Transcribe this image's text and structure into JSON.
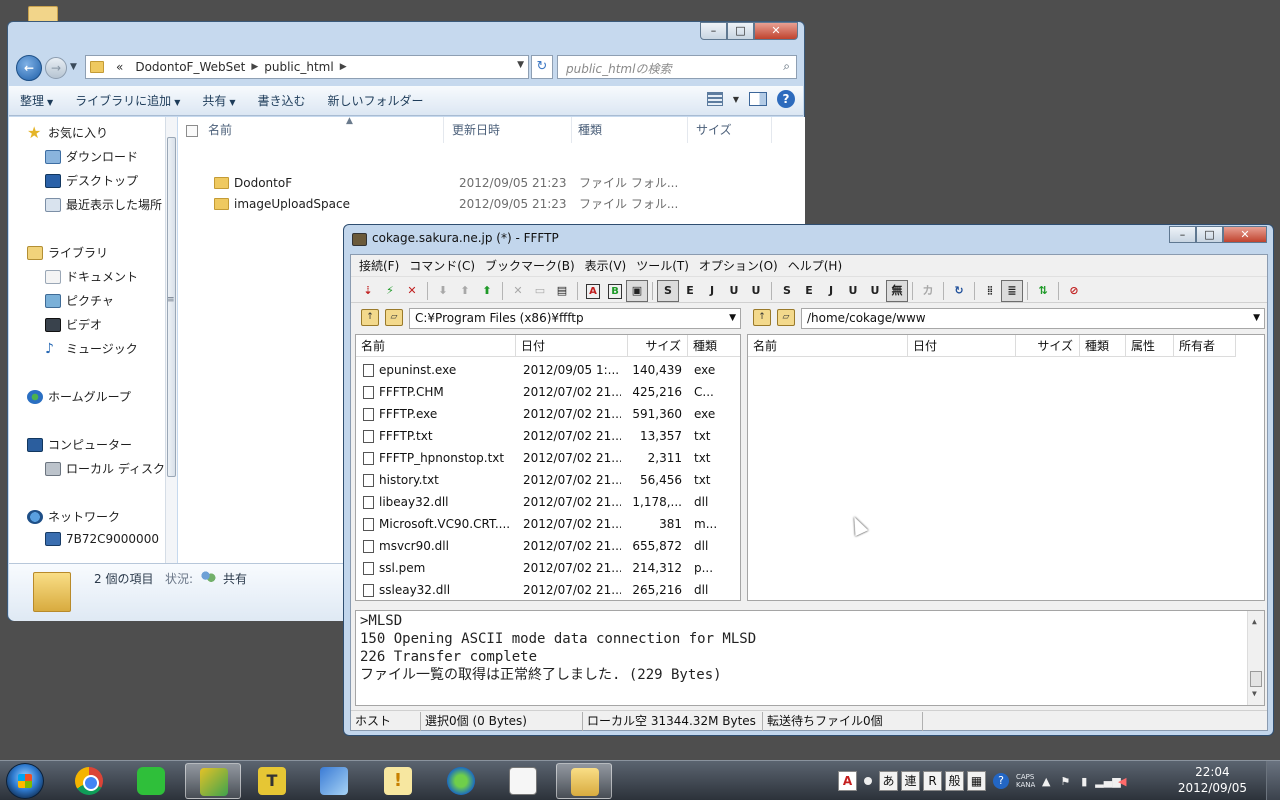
{
  "explorer": {
    "breadcrumb": [
      "«",
      "DodontoF_WebSet",
      "public_html"
    ],
    "search_placeholder": "public_htmlの検索",
    "commands": [
      "整理",
      "ライブラリに追加",
      "共有",
      "書き込む",
      "新しいフォルダー"
    ],
    "nav": {
      "favorites": "お気に入り",
      "downloads": "ダウンロード",
      "desktop": "デスクトップ",
      "recent": "最近表示した場所",
      "libraries": "ライブラリ",
      "documents": "ドキュメント",
      "pictures": "ピクチャ",
      "videos": "ビデオ",
      "music": "ミュージック",
      "homegroup": "ホームグループ",
      "computer": "コンピューター",
      "local_disk": "ローカル ディスク",
      "network": "ネットワーク",
      "network_pc": "7B72C9000000"
    },
    "columns": {
      "name": "名前",
      "date": "更新日時",
      "type": "種類",
      "size": "サイズ"
    },
    "files": [
      {
        "name": "DodontoF",
        "date": "2012/09/05 21:23",
        "type": "ファイル フォル..."
      },
      {
        "name": "imageUploadSpace",
        "date": "2012/09/05 21:23",
        "type": "ファイル フォル..."
      }
    ],
    "status": {
      "count": "2 個の項目",
      "state": "状況:",
      "share": "共有"
    }
  },
  "ffftp": {
    "title": "cokage.sakura.ne.jp (*) - FFFTP",
    "menu": [
      "接続(F)",
      "コマンド(C)",
      "ブックマーク(B)",
      "表示(V)",
      "ツール(T)",
      "オプション(O)",
      "ヘルプ(H)"
    ],
    "local_path": "C:¥Program Files (x86)¥ffftp",
    "remote_path": "/home/cokage/www",
    "local_columns": {
      "name": "名前",
      "date": "日付",
      "size": "サイズ",
      "type": "種類"
    },
    "remote_columns": {
      "name": "名前",
      "date": "日付",
      "size": "サイズ",
      "type": "種類",
      "attr": "属性",
      "owner": "所有者"
    },
    "local_files": [
      {
        "name": "epuninst.exe",
        "date": "2012/09/05  1:...",
        "size": "140,439",
        "type": "exe"
      },
      {
        "name": "FFFTP.CHM",
        "date": "2012/07/02 21...",
        "size": "425,216",
        "type": "C..."
      },
      {
        "name": "FFFTP.exe",
        "date": "2012/07/02 21...",
        "size": "591,360",
        "type": "exe"
      },
      {
        "name": "FFFTP.txt",
        "date": "2012/07/02 21...",
        "size": "13,357",
        "type": "txt"
      },
      {
        "name": "FFFTP_hpnonstop.txt",
        "date": "2012/07/02 21...",
        "size": "2,311",
        "type": "txt"
      },
      {
        "name": "history.txt",
        "date": "2012/07/02 21...",
        "size": "56,456",
        "type": "txt"
      },
      {
        "name": "libeay32.dll",
        "date": "2012/07/02 21...",
        "size": "1,178,...",
        "type": "dll"
      },
      {
        "name": "Microsoft.VC90.CRT....",
        "date": "2012/07/02 21...",
        "size": "381",
        "type": "m..."
      },
      {
        "name": "msvcr90.dll",
        "date": "2012/07/02 21...",
        "size": "655,872",
        "type": "dll"
      },
      {
        "name": "ssl.pem",
        "date": "2012/07/02 21...",
        "size": "214,312",
        "type": "p..."
      },
      {
        "name": "ssleay32.dll",
        "date": "2012/07/02 21...",
        "size": "265,216",
        "type": "dll"
      }
    ],
    "log": [
      ">MLSD",
      "150 Opening ASCII mode data connection for MLSD",
      "226 Transfer complete",
      "ファイル一覧の取得は正常終了しました. (229 Bytes)"
    ],
    "status": {
      "host": "ホスト",
      "selection": "選択0個 (0 Bytes)",
      "local_free": "ローカル空 31344.32M Bytes",
      "queue": "転送待ちファイル0個"
    }
  },
  "taskbar": {
    "ime": [
      "あ",
      "連",
      "R",
      "般"
    ],
    "caps": "CAPS",
    "kana": "KANA",
    "time": "22:04",
    "date": "2012/09/05"
  }
}
